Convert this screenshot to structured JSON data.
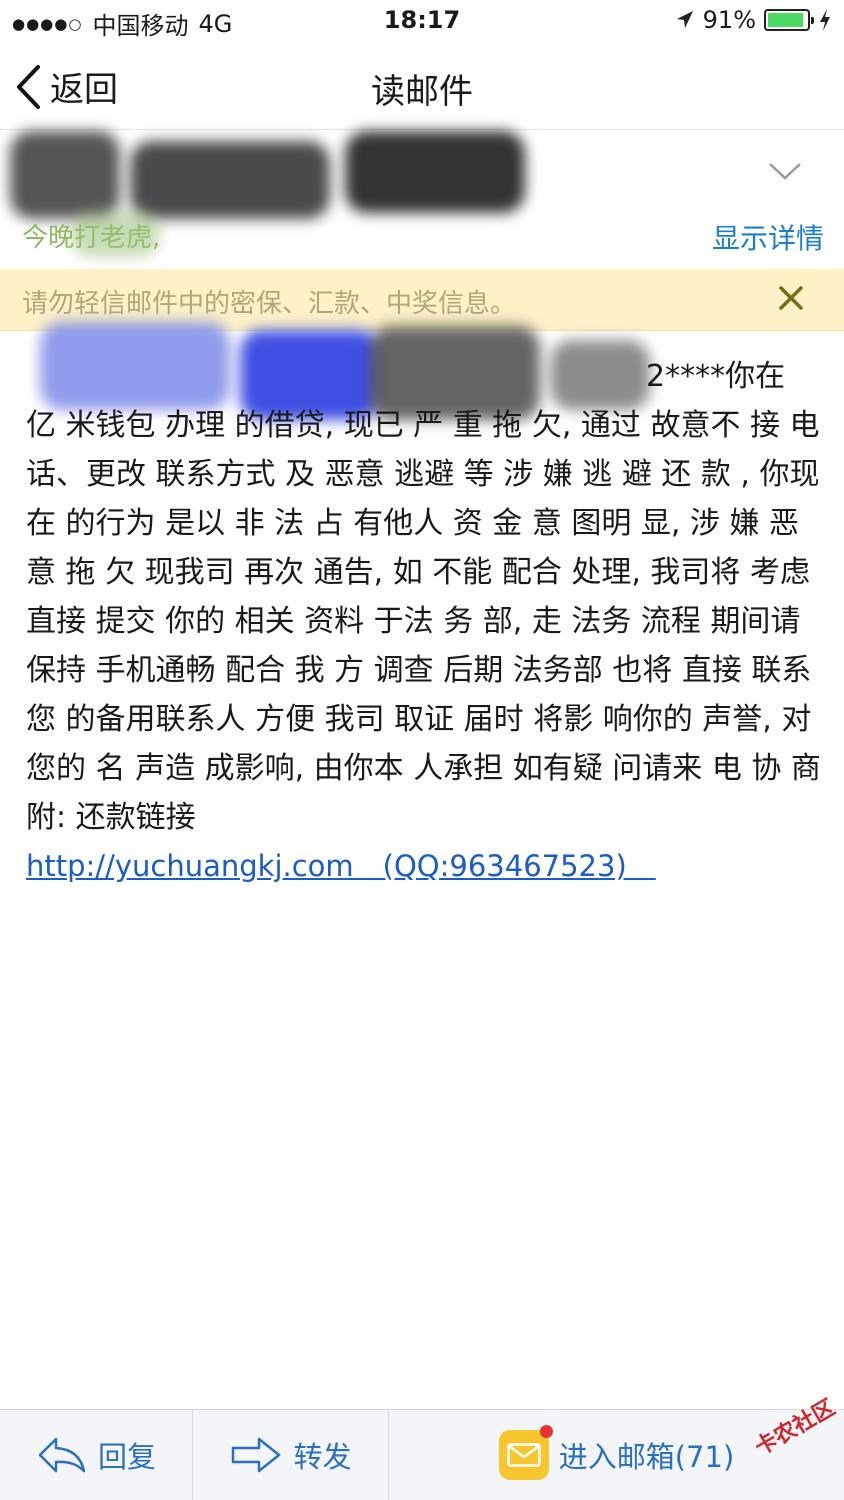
{
  "status_bar": {
    "signal": "●●●●○",
    "carrier": "中国移动",
    "network": "4G",
    "time": "18:17",
    "battery": "91%",
    "battery_level": 0.91,
    "battery_color": "#4cd964"
  },
  "nav": {
    "back_label": "返回",
    "title": "读邮件"
  },
  "header": {
    "subject": "今晚打老虎,",
    "show_details": "显示详情"
  },
  "warning": {
    "text": "请勿轻信邮件中的密保、汇款、中奖信息。"
  },
  "body": {
    "first_visible": "2****你在 亿",
    "text": "米钱包 办理 的借贷, 现已 严 重 拖 欠, 通过 故意不 接 电话、更改 联系方式 及 恶意 逃避 等 涉 嫌 逃 避 还 款 , 你现在 的行为 是以 非 法 占 有他人 资 金 意 图明 显, 涉 嫌 恶 意 拖 欠 现我司 再次 通告, 如 不能 配合 处理, 我司将 考虑 直接 提交 你的 相关 资料 于法 务 部, 走 法务 流程 期间请保持 手机通畅 配合 我 方 调查 后期 法务部 也将 直接 联系您 的备用联系人 方便 我司 取证 届时 将影 响你的 声誉, 对您的 名 声造 成影响, 由你本 人承担 如有疑 问请来 电 协 商 附: 还款链接",
    "link": "http://yuchuangkj.com　(QQ:963467523)　"
  },
  "toolbar": {
    "reply": "回复",
    "forward": "转发",
    "inbox": "进入邮箱(71)"
  },
  "watermark": "卡农社区",
  "colors": {
    "accent": "#1a7dd1",
    "warning_bg": "#fcf1c7",
    "mail_icon": "#f7c52d"
  }
}
